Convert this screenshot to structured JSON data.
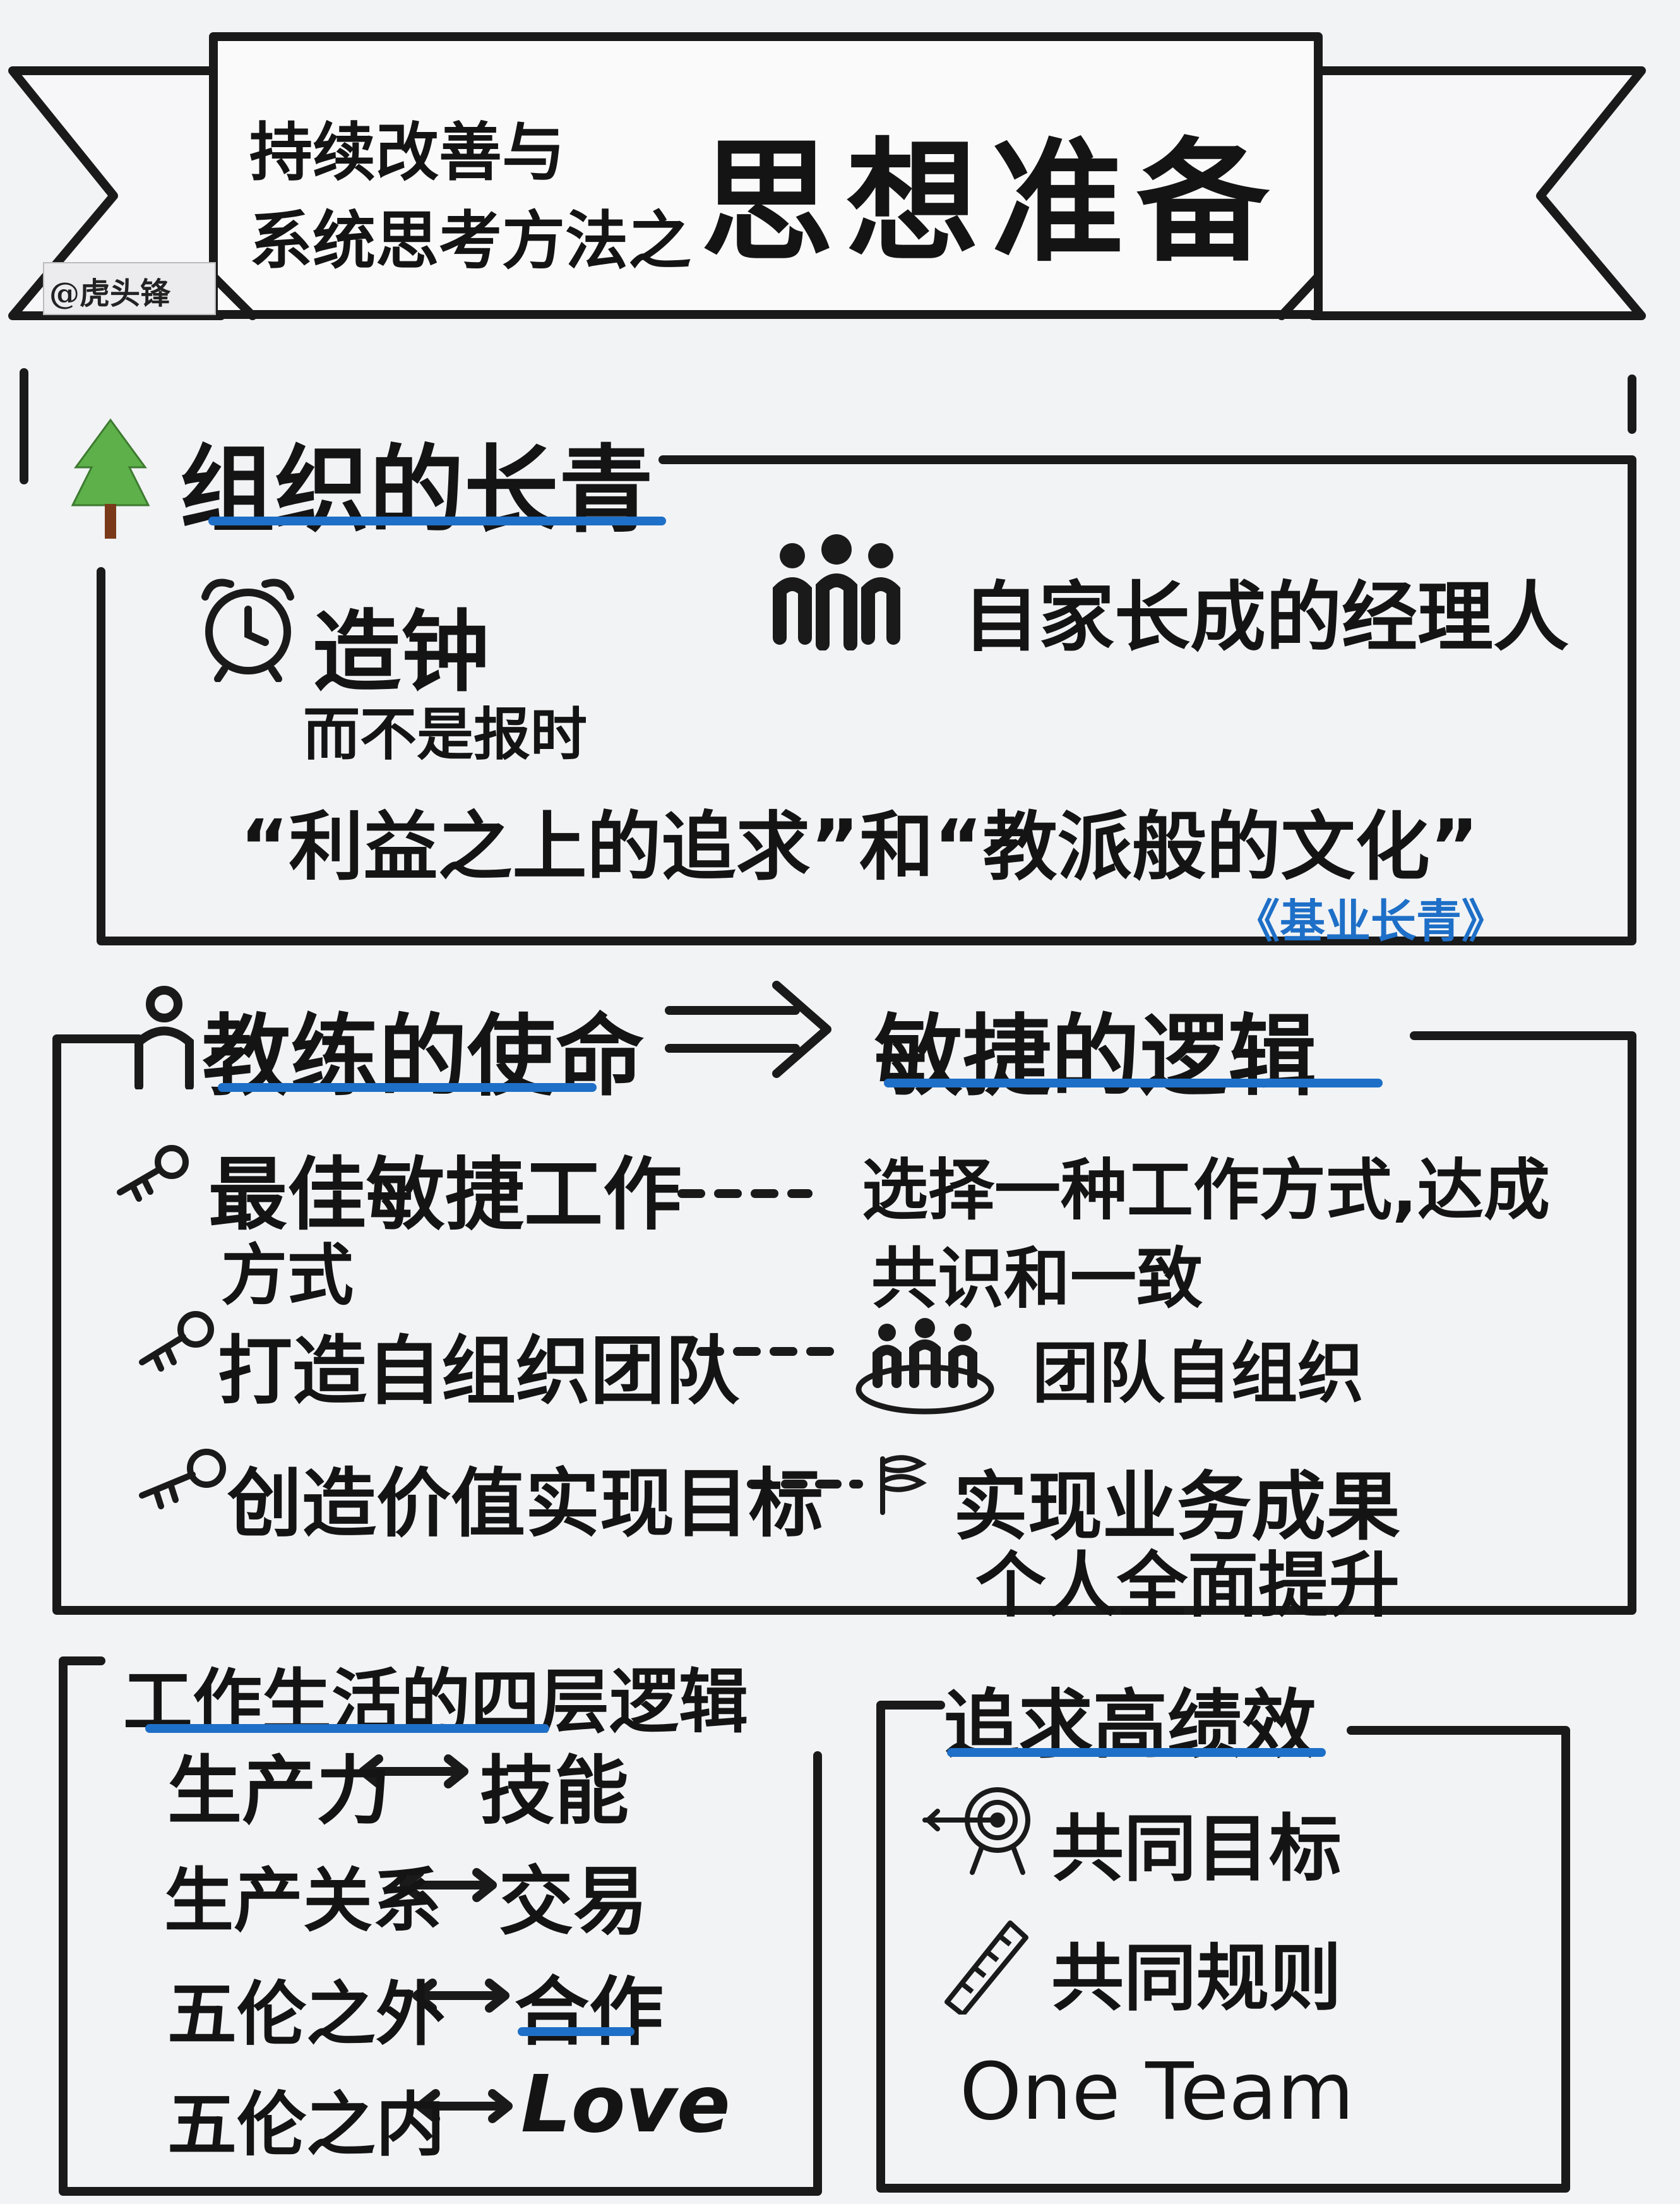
{
  "banner": {
    "subtitle_line1": "持续改善与",
    "subtitle_line2": "系统思考方法之",
    "title": "思想准备",
    "watermark": "@虎头锋"
  },
  "section1": {
    "heading": "组织的长青",
    "clock_title": "造钟",
    "clock_sub": "而不是报时",
    "manager": "自家长成的经理人",
    "quote": "“利益之上的追求”和“教派般的文化”",
    "book": "《基业长青》"
  },
  "section2": {
    "heading_left": "教练的使命",
    "heading_right": "敏捷的逻辑",
    "rows": [
      {
        "left_line1": "最佳敏捷工作",
        "left_line2": "方式",
        "right_line1": "选择一种工作方式,达成",
        "right_line2": "共识和一致"
      },
      {
        "left_line1": "打造自组织团队",
        "left_line2": "",
        "right_line1": "团队自组织",
        "right_line2": ""
      },
      {
        "left_line1": "创造价值实现目标",
        "left_line2": "",
        "right_line1": "实现业务成果",
        "right_line2": "个人全面提升"
      }
    ]
  },
  "section3": {
    "heading": "工作生活的四层逻辑",
    "rows": [
      {
        "left": "生产力",
        "right": "技能"
      },
      {
        "left": "生产关系",
        "right": "交易"
      },
      {
        "left": "五伦之外",
        "right": "合作"
      },
      {
        "left": "五伦之内",
        "right": "Love"
      }
    ]
  },
  "section4": {
    "heading": "追求高绩效",
    "items": [
      "共同目标",
      "共同规则",
      "One Team"
    ]
  },
  "colors": {
    "accent_blue": "#1e6fc7",
    "ink": "#141414",
    "tree_green": "#5db04a",
    "trunk_brown": "#7a3a1a"
  }
}
